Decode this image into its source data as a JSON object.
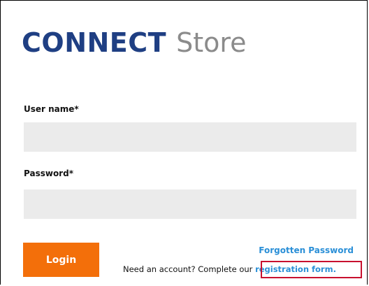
{
  "logo": {
    "brand": "CONNECT",
    "product": "Store"
  },
  "form": {
    "username_label": "User name*",
    "username_value": "",
    "password_label": "Password*",
    "password_value": "",
    "login_label": "Login",
    "forgot_label": "Forgotten Password",
    "need_account_text": "Need an account? Complete our ",
    "registration_label": "registration form."
  },
  "colors": {
    "brand": "#1f3f83",
    "accent_button": "#f36f0a",
    "link": "#2a8fd7",
    "highlight": "#c8102e"
  }
}
